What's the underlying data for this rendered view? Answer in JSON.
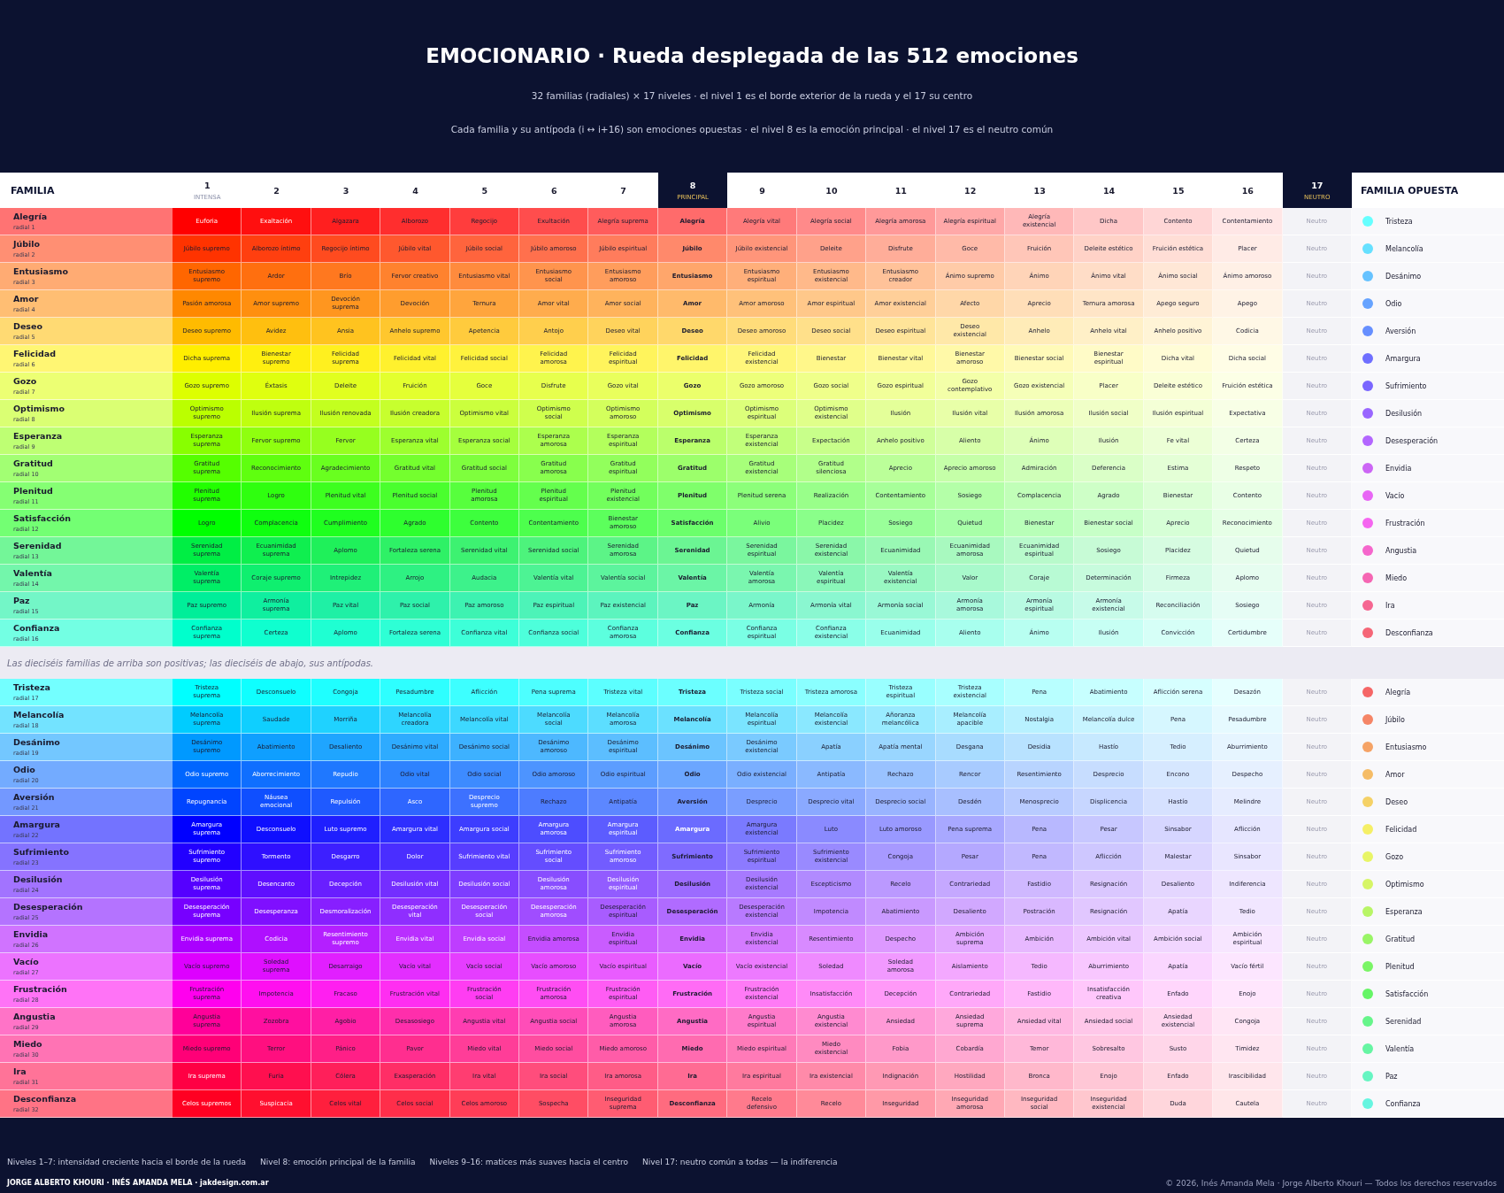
{
  "header": {
    "title": "EMOCIONARIO · Rueda desplegada de las 512 emociones",
    "subtitle": "32 familias (radiales) × 17 niveles · el nivel 1 es el borde exterior de la rueda y el 17 su centro",
    "note": "Cada familia y su antípoda (i ↔ i+16) son emociones opuestas · el nivel 8 es la emoción principal · el nivel 17 es el neutro común"
  },
  "table": {
    "family_heading": "FAMILIA",
    "opposite_heading": "FAMILIA OPUESTA",
    "columns": [
      {
        "number": "1",
        "sublabel": "INTENSA",
        "kind": "level"
      },
      {
        "number": "2",
        "kind": "level"
      },
      {
        "number": "3",
        "kind": "level"
      },
      {
        "number": "4",
        "kind": "level"
      },
      {
        "number": "5",
        "kind": "level"
      },
      {
        "number": "6",
        "kind": "level"
      },
      {
        "number": "7",
        "kind": "level"
      },
      {
        "number": "8",
        "sublabel": "PRINCIPAL",
        "kind": "principal"
      },
      {
        "number": "9",
        "kind": "level"
      },
      {
        "number": "10",
        "kind": "level"
      },
      {
        "number": "11",
        "kind": "level"
      },
      {
        "number": "12",
        "kind": "level"
      },
      {
        "number": "13",
        "kind": "level"
      },
      {
        "number": "14",
        "kind": "level"
      },
      {
        "number": "15",
        "kind": "level"
      },
      {
        "number": "16",
        "kind": "level"
      },
      {
        "number": "17",
        "sublabel": "NEUTRO",
        "kind": "neutral"
      }
    ],
    "positive_families": [
      {
        "name": "Alegría",
        "radial": "radial 1",
        "color": "#ff0000",
        "levels": [
          "Euforia",
          "Exaltación",
          "Algazara",
          "Alborozo",
          "Regocijo",
          "Exultación",
          "Alegría suprema",
          "Alegría",
          "Alegría vital",
          "Alegría social",
          "Alegría amorosa",
          "Alegría espiritual",
          "Alegría existencial",
          "Dicha",
          "Contento",
          "Contentamiento",
          "Neutro"
        ],
        "opposite": {
          "name": "Tristeza",
          "color": "#66ffff"
        }
      },
      {
        "name": "Júbilo",
        "radial": "radial 2",
        "color": "#ff3300",
        "levels": [
          "Júbilo supremo",
          "Alborozo íntimo",
          "Regocijo íntimo",
          "Júbilo vital",
          "Júbilo social",
          "Júbilo amoroso",
          "Júbilo espiritual",
          "Júbilo",
          "Júbilo existencial",
          "Deleite",
          "Disfrute",
          "Goce",
          "Fruición",
          "Deleite estético",
          "Fruición estética",
          "Placer",
          "Neutro"
        ],
        "opposite": {
          "name": "Melancolía",
          "color": "#66e0ff"
        }
      },
      {
        "name": "Entusiasmo",
        "radial": "radial 3",
        "color": "#ff6600",
        "levels": [
          "Entusiasmo supremo",
          "Ardor",
          "Brío",
          "Fervor creativo",
          "Entusiasmo vital",
          "Entusiasmo social",
          "Entusiasmo amoroso",
          "Entusiasmo",
          "Entusiasmo espiritual",
          "Entusiasmo existencial",
          "Entusiasmo creador",
          "Ánimo supremo",
          "Ánimo",
          "Ánimo vital",
          "Ánimo social",
          "Ánimo amoroso",
          "Neutro"
        ],
        "opposite": {
          "name": "Desánimo",
          "color": "#66c2ff"
        }
      },
      {
        "name": "Amor",
        "radial": "radial 4",
        "color": "#ff8800",
        "levels": [
          "Pasión amorosa",
          "Amor supremo",
          "Devoción suprema",
          "Devoción",
          "Ternura",
          "Amor vital",
          "Amor social",
          "Amor",
          "Amor amoroso",
          "Amor espiritual",
          "Amor existencial",
          "Afecto",
          "Aprecio",
          "Ternura amorosa",
          "Apego seguro",
          "Apego",
          "Neutro"
        ],
        "opposite": {
          "name": "Odio",
          "color": "#66a3ff"
        }
      },
      {
        "name": "Deseo",
        "radial": "radial 5",
        "color": "#ffbb00",
        "levels": [
          "Deseo supremo",
          "Avidez",
          "Ansia",
          "Anhelo supremo",
          "Apetencia",
          "Antojo",
          "Deseo vital",
          "Deseo",
          "Deseo amoroso",
          "Deseo social",
          "Deseo espiritual",
          "Deseo existencial",
          "Anhelo",
          "Anhelo vital",
          "Anhelo positivo",
          "Codicia",
          "Neutro"
        ],
        "opposite": {
          "name": "Aversión",
          "color": "#668fff"
        }
      },
      {
        "name": "Felicidad",
        "radial": "radial 6",
        "color": "#ffee00",
        "levels": [
          "Dicha suprema",
          "Bienestar supremo",
          "Felicidad suprema",
          "Felicidad vital",
          "Felicidad social",
          "Felicidad amorosa",
          "Felicidad espiritual",
          "Felicidad",
          "Felicidad existencial",
          "Bienestar",
          "Bienestar vital",
          "Bienestar amoroso",
          "Bienestar social",
          "Bienestar espiritual",
          "Dicha vital",
          "Dicha social",
          "Neutro"
        ],
        "opposite": {
          "name": "Amargura",
          "color": "#6f6fff"
        }
      },
      {
        "name": "Gozo",
        "radial": "radial 7",
        "color": "#ddff00",
        "levels": [
          "Gozo supremo",
          "Éxtasis",
          "Deleite",
          "Fruición",
          "Goce",
          "Disfrute",
          "Gozo vital",
          "Gozo",
          "Gozo amoroso",
          "Gozo social",
          "Gozo espiritual",
          "Gozo contemplativo",
          "Gozo existencial",
          "Placer",
          "Deleite estético",
          "Fruición estética",
          "Neutro"
        ],
        "opposite": {
          "name": "Sufrimiento",
          "color": "#7a66ff"
        }
      },
      {
        "name": "Optimismo",
        "radial": "radial 8",
        "color": "#bbff00",
        "levels": [
          "Optimismo supremo",
          "Ilusión suprema",
          "Ilusión renovada",
          "Ilusión creadora",
          "Optimismo vital",
          "Optimismo social",
          "Optimismo amoroso",
          "Optimismo",
          "Optimismo espiritual",
          "Optimismo existencial",
          "Ilusión",
          "Ilusión vital",
          "Ilusión amorosa",
          "Ilusión social",
          "Ilusión espiritual",
          "Expectativa",
          "Neutro"
        ],
        "opposite": {
          "name": "Desilusión",
          "color": "#9966ff"
        }
      },
      {
        "name": "Esperanza",
        "radial": "radial 9",
        "color": "#88ff00",
        "levels": [
          "Esperanza suprema",
          "Fervor supremo",
          "Fervor",
          "Esperanza vital",
          "Esperanza social",
          "Esperanza amorosa",
          "Esperanza espiritual",
          "Esperanza",
          "Esperanza existencial",
          "Expectación",
          "Anhelo positivo",
          "Aliento",
          "Ánimo",
          "Ilusión",
          "Fe vital",
          "Certeza",
          "Neutro"
        ],
        "opposite": {
          "name": "Desesperación",
          "color": "#b366ff"
        }
      },
      {
        "name": "Gratitud",
        "radial": "radial 10",
        "color": "#55ff00",
        "levels": [
          "Gratitud suprema",
          "Reconocimiento",
          "Agradecimiento",
          "Gratitud vital",
          "Gratitud social",
          "Gratitud amorosa",
          "Gratitud espiritual",
          "Gratitud",
          "Gratitud existencial",
          "Gratitud silenciosa",
          "Aprecio",
          "Aprecio amoroso",
          "Admiración",
          "Deferencia",
          "Estima",
          "Respeto",
          "Neutro"
        ],
        "opposite": {
          "name": "Envidia",
          "color": "#cc66f5"
        }
      },
      {
        "name": "Plenitud",
        "radial": "radial 11",
        "color": "#22ff00",
        "levels": [
          "Plenitud suprema",
          "Logro",
          "Plenitud vital",
          "Plenitud social",
          "Plenitud amorosa",
          "Plenitud espiritual",
          "Plenitud existencial",
          "Plenitud",
          "Plenitud serena",
          "Realización",
          "Contentamiento",
          "Sosiego",
          "Complacencia",
          "Agrado",
          "Bienestar",
          "Contento",
          "Neutro"
        ],
        "opposite": {
          "name": "Vacío",
          "color": "#e866f5"
        }
      },
      {
        "name": "Satisfacción",
        "radial": "radial 12",
        "color": "#00ff00",
        "levels": [
          "Logro",
          "Complacencia",
          "Cumplimiento",
          "Agrado",
          "Contento",
          "Contentamiento",
          "Bienestar amoroso",
          "Satisfacción",
          "Alivio",
          "Placidez",
          "Sosiego",
          "Quietud",
          "Bienestar",
          "Bienestar social",
          "Aprecio",
          "Reconocimiento",
          "Neutro"
        ],
        "opposite": {
          "name": "Frustración",
          "color": "#f566f0"
        }
      },
      {
        "name": "Serenidad",
        "radial": "radial 13",
        "color": "#00ee44",
        "levels": [
          "Serenidad suprema",
          "Ecuanimidad suprema",
          "Aplomo",
          "Fortaleza serena",
          "Serenidad vital",
          "Serenidad social",
          "Serenidad amorosa",
          "Serenidad",
          "Serenidad espiritual",
          "Serenidad existencial",
          "Ecuanimidad",
          "Ecuanimidad amorosa",
          "Ecuanimidad espiritual",
          "Sosiego",
          "Placidez",
          "Quietud",
          "Neutro"
        ],
        "opposite": {
          "name": "Angustia",
          "color": "#f566cc"
        }
      },
      {
        "name": "Valentía",
        "radial": "radial 14",
        "color": "#00ee66",
        "levels": [
          "Valentía suprema",
          "Coraje supremo",
          "Intrepidez",
          "Arrojo",
          "Audacia",
          "Valentía vital",
          "Valentía social",
          "Valentía",
          "Valentía amorosa",
          "Valentía espiritual",
          "Valentía existencial",
          "Valor",
          "Coraje",
          "Determinación",
          "Firmeza",
          "Aplomo",
          "Neutro"
        ],
        "opposite": {
          "name": "Miedo",
          "color": "#f566b3"
        }
      },
      {
        "name": "Paz",
        "radial": "radial 15",
        "color": "#00ee99",
        "levels": [
          "Paz supremo",
          "Armonía suprema",
          "Paz vital",
          "Paz social",
          "Paz amoroso",
          "Paz espiritual",
          "Paz existencial",
          "Paz",
          "Armonía",
          "Armonía vital",
          "Armonía social",
          "Armonía amorosa",
          "Armonía espiritual",
          "Armonía existencial",
          "Reconciliación",
          "Sosiego",
          "Neutro"
        ],
        "opposite": {
          "name": "Ira",
          "color": "#f56691"
        }
      },
      {
        "name": "Confianza",
        "radial": "radial 16",
        "color": "#00ffcc",
        "levels": [
          "Confianza suprema",
          "Certeza",
          "Aplomo",
          "Fortaleza serena",
          "Confianza vital",
          "Confianza social",
          "Confianza amorosa",
          "Confianza",
          "Confianza espiritual",
          "Confianza existencial",
          "Ecuanimidad",
          "Aliento",
          "Ánimo",
          "Ilusión",
          "Convicción",
          "Certidumbre",
          "Neutro"
        ],
        "opposite": {
          "name": "Desconfianza",
          "color": "#f56677"
        }
      }
    ],
    "separator_note": "Las dieciséis familias de arriba son positivas; las dieciséis de abajo, sus antípodas.",
    "negative_families": [
      {
        "name": "Tristeza",
        "radial": "radial 17",
        "color": "#00ffff",
        "levels": [
          "Tristeza suprema",
          "Desconsuelo",
          "Congoja",
          "Pesadumbre",
          "Aflicción",
          "Pena suprema",
          "Tristeza vital",
          "Tristeza",
          "Tristeza social",
          "Tristeza amorosa",
          "Tristeza espiritual",
          "Tristeza existencial",
          "Pena",
          "Abatimiento",
          "Aflicción serena",
          "Desazón",
          "Neutro"
        ],
        "opposite": {
          "name": "Alegría",
          "color": "#f56666"
        }
      },
      {
        "name": "Melancolía",
        "radial": "radial 18",
        "color": "#00ccff",
        "levels": [
          "Melancolía suprema",
          "Saudade",
          "Morriña",
          "Melancolía creadora",
          "Melancolía vital",
          "Melancolía social",
          "Melancolía amorosa",
          "Melancolía",
          "Melancolía espiritual",
          "Melancolía existencial",
          "Añoranza melancólica",
          "Melancolía apacible",
          "Nostalgia",
          "Melancolía dulce",
          "Pena",
          "Pesadumbre",
          "Neutro"
        ],
        "opposite": {
          "name": "Júbilo",
          "color": "#f58566"
        }
      },
      {
        "name": "Desánimo",
        "radial": "radial 19",
        "color": "#0099ff",
        "levels": [
          "Desánimo supremo",
          "Abatimiento",
          "Desaliento",
          "Desánimo vital",
          "Desánimo social",
          "Desánimo amoroso",
          "Desánimo espiritual",
          "Desánimo",
          "Desánimo existencial",
          "Apatía",
          "Apatía mental",
          "Desgana",
          "Desidia",
          "Hastío",
          "Tedio",
          "Aburrimiento",
          "Neutro"
        ],
        "opposite": {
          "name": "Entusiasmo",
          "color": "#f5a366"
        }
      },
      {
        "name": "Odio",
        "radial": "radial 20",
        "color": "#0066ff",
        "levels": [
          "Odio supremo",
          "Aborrecimiento",
          "Repudio",
          "Odio vital",
          "Odio social",
          "Odio amoroso",
          "Odio espiritual",
          "Odio",
          "Odio existencial",
          "Antipatía",
          "Rechazo",
          "Rencor",
          "Resentimiento",
          "Desprecio",
          "Encono",
          "Despecho",
          "Neutro"
        ],
        "opposite": {
          "name": "Amor",
          "color": "#f5bc66"
        }
      },
      {
        "name": "Aversión",
        "radial": "radial 21",
        "color": "#0044ff",
        "levels": [
          "Repugnancia",
          "Náusea emocional",
          "Repulsión",
          "Asco",
          "Desprecio supremo",
          "Rechazo",
          "Antipatía",
          "Aversión",
          "Desprecio",
          "Desprecio vital",
          "Desprecio social",
          "Desdén",
          "Menosprecio",
          "Displicencia",
          "Hastío",
          "Melindre",
          "Neutro"
        ],
        "opposite": {
          "name": "Deseo",
          "color": "#f5d166"
        }
      },
      {
        "name": "Amargura",
        "radial": "radial 22",
        "color": "#0000ff",
        "levels": [
          "Amargura suprema",
          "Desconsuelo",
          "Luto supremo",
          "Amargura vital",
          "Amargura social",
          "Amargura amorosa",
          "Amargura espiritual",
          "Amargura",
          "Amargura existencial",
          "Luto",
          "Luto amoroso",
          "Pena suprema",
          "Pena",
          "Pesar",
          "Sinsabor",
          "Aflicción",
          "Neutro"
        ],
        "opposite": {
          "name": "Felicidad",
          "color": "#f5ef66"
        }
      },
      {
        "name": "Sufrimiento",
        "radial": "radial 23",
        "color": "#2200ff",
        "levels": [
          "Sufrimiento supremo",
          "Tormento",
          "Desgarro",
          "Dolor",
          "Sufrimiento vital",
          "Sufrimiento social",
          "Sufrimiento amoroso",
          "Sufrimiento",
          "Sufrimiento espiritual",
          "Sufrimiento existencial",
          "Congoja",
          "Pesar",
          "Pena",
          "Aflicción",
          "Malestar",
          "Sinsabor",
          "Neutro"
        ],
        "opposite": {
          "name": "Gozo",
          "color": "#e8f566"
        }
      },
      {
        "name": "Desilusión",
        "radial": "radial 24",
        "color": "#5500ff",
        "levels": [
          "Desilusión suprema",
          "Desencanto",
          "Decepción",
          "Desilusión vital",
          "Desilusión social",
          "Desilusión amorosa",
          "Desilusión espiritual",
          "Desilusión",
          "Desilusión existencial",
          "Escepticismo",
          "Recelo",
          "Contrariedad",
          "Fastidio",
          "Resignación",
          "Desaliento",
          "Indiferencia",
          "Neutro"
        ],
        "opposite": {
          "name": "Optimismo",
          "color": "#d6f566"
        }
      },
      {
        "name": "Desesperación",
        "radial": "radial 25",
        "color": "#7700ff",
        "levels": [
          "Desesperación suprema",
          "Desesperanza",
          "Desmoralización",
          "Desesperación vital",
          "Desesperación social",
          "Desesperación amorosa",
          "Desesperación espiritual",
          "Desesperación",
          "Desesperación existencial",
          "Impotencia",
          "Abatimiento",
          "Desaliento",
          "Postración",
          "Resignación",
          "Apatía",
          "Tedio",
          "Neutro"
        ],
        "opposite": {
          "name": "Esperanza",
          "color": "#b8f566"
        }
      },
      {
        "name": "Envidia",
        "radial": "radial 26",
        "color": "#aa00ff",
        "levels": [
          "Envidia suprema",
          "Codicia",
          "Resentimiento supremo",
          "Envidia vital",
          "Envidia social",
          "Envidia amorosa",
          "Envidia espiritual",
          "Envidia",
          "Envidia existencial",
          "Resentimiento",
          "Despecho",
          "Ambición suprema",
          "Ambición",
          "Ambición vital",
          "Ambición social",
          "Ambición espiritual",
          "Neutro"
        ],
        "opposite": {
          "name": "Gratitud",
          "color": "#99f566"
        }
      },
      {
        "name": "Vacío",
        "radial": "radial 27",
        "color": "#dd00ff",
        "levels": [
          "Vacío supremo",
          "Soledad suprema",
          "Desarraigo",
          "Vacío vital",
          "Vacío social",
          "Vacío amoroso",
          "Vacío espiritual",
          "Vacío",
          "Vacío existencial",
          "Soledad",
          "Soledad amorosa",
          "Aislamiento",
          "Tedio",
          "Aburrimiento",
          "Apatía",
          "Vacío fértil",
          "Neutro"
        ],
        "opposite": {
          "name": "Plenitud",
          "color": "#7af566"
        }
      },
      {
        "name": "Frustración",
        "radial": "radial 28",
        "color": "#ff00ee",
        "levels": [
          "Frustración suprema",
          "Impotencia",
          "Fracaso",
          "Frustración vital",
          "Frustración social",
          "Frustración amorosa",
          "Frustración espiritual",
          "Frustración",
          "Frustración existencial",
          "Insatisfacción",
          "Decepción",
          "Contrariedad",
          "Fastidio",
          "Insatisfacción creativa",
          "Enfado",
          "Enojo",
          "Neutro"
        ],
        "opposite": {
          "name": "Satisfacción",
          "color": "#66f566"
        }
      },
      {
        "name": "Angustia",
        "radial": "radial 29",
        "color": "#ff0099",
        "levels": [
          "Angustia suprema",
          "Zozobra",
          "Agobio",
          "Desasosiego",
          "Angustia vital",
          "Angustia social",
          "Angustia amorosa",
          "Angustia",
          "Angustia espiritual",
          "Angustia existencial",
          "Ansiedad",
          "Ansiedad suprema",
          "Ansiedad vital",
          "Ansiedad social",
          "Ansiedad existencial",
          "Congoja",
          "Neutro"
        ],
        "opposite": {
          "name": "Serenidad",
          "color": "#66f58a"
        }
      },
      {
        "name": "Miedo",
        "radial": "radial 30",
        "color": "#ff0077",
        "levels": [
          "Miedo supremo",
          "Terror",
          "Pánico",
          "Pavor",
          "Miedo vital",
          "Miedo social",
          "Miedo amoroso",
          "Miedo",
          "Miedo espiritual",
          "Miedo existencial",
          "Fobia",
          "Cobardía",
          "Temor",
          "Sobresalto",
          "Susto",
          "Timidez",
          "Neutro"
        ],
        "opposite": {
          "name": "Valentía",
          "color": "#66f5a3"
        }
      },
      {
        "name": "Ira",
        "radial": "radial 31",
        "color": "#ff0044",
        "levels": [
          "Ira suprema",
          "Furia",
          "Cólera",
          "Exasperación",
          "Ira vital",
          "Ira social",
          "Ira amorosa",
          "Ira",
          "Ira espiritual",
          "Ira existencial",
          "Indignación",
          "Hostilidad",
          "Bronca",
          "Enojo",
          "Enfado",
          "Irascibilidad",
          "Neutro"
        ],
        "opposite": {
          "name": "Paz",
          "color": "#66f5c2"
        }
      },
      {
        "name": "Desconfianza",
        "radial": "radial 32",
        "color": "#ff0022",
        "levels": [
          "Celos supremos",
          "Suspicacia",
          "Celos vital",
          "Celos social",
          "Celos amoroso",
          "Sospecha",
          "Inseguridad suprema",
          "Desconfianza",
          "Recelo defensivo",
          "Recelo",
          "Inseguridad",
          "Inseguridad amorosa",
          "Inseguridad social",
          "Inseguridad existencial",
          "Duda",
          "Cautela",
          "Neutro"
        ],
        "opposite": {
          "name": "Confianza",
          "color": "#66f5e0"
        }
      }
    ]
  },
  "footer": {
    "legend": [
      "Niveles 1–7: intensidad creciente hacia el borde de la rueda",
      "Nivel 8: emoción principal de la familia",
      "Niveles 9–16: matices más suaves hacia el centro",
      "Nivel 17: neutro común a todas — la indiferencia"
    ],
    "credits": "JORGE ALBERTO KHOURI · INÉS AMANDA MELA · jakdesign.com.ar",
    "copyright": "© 2026, Inés Amanda Mela · Jorge Alberto Khouri — Todos los derechos reservados"
  }
}
